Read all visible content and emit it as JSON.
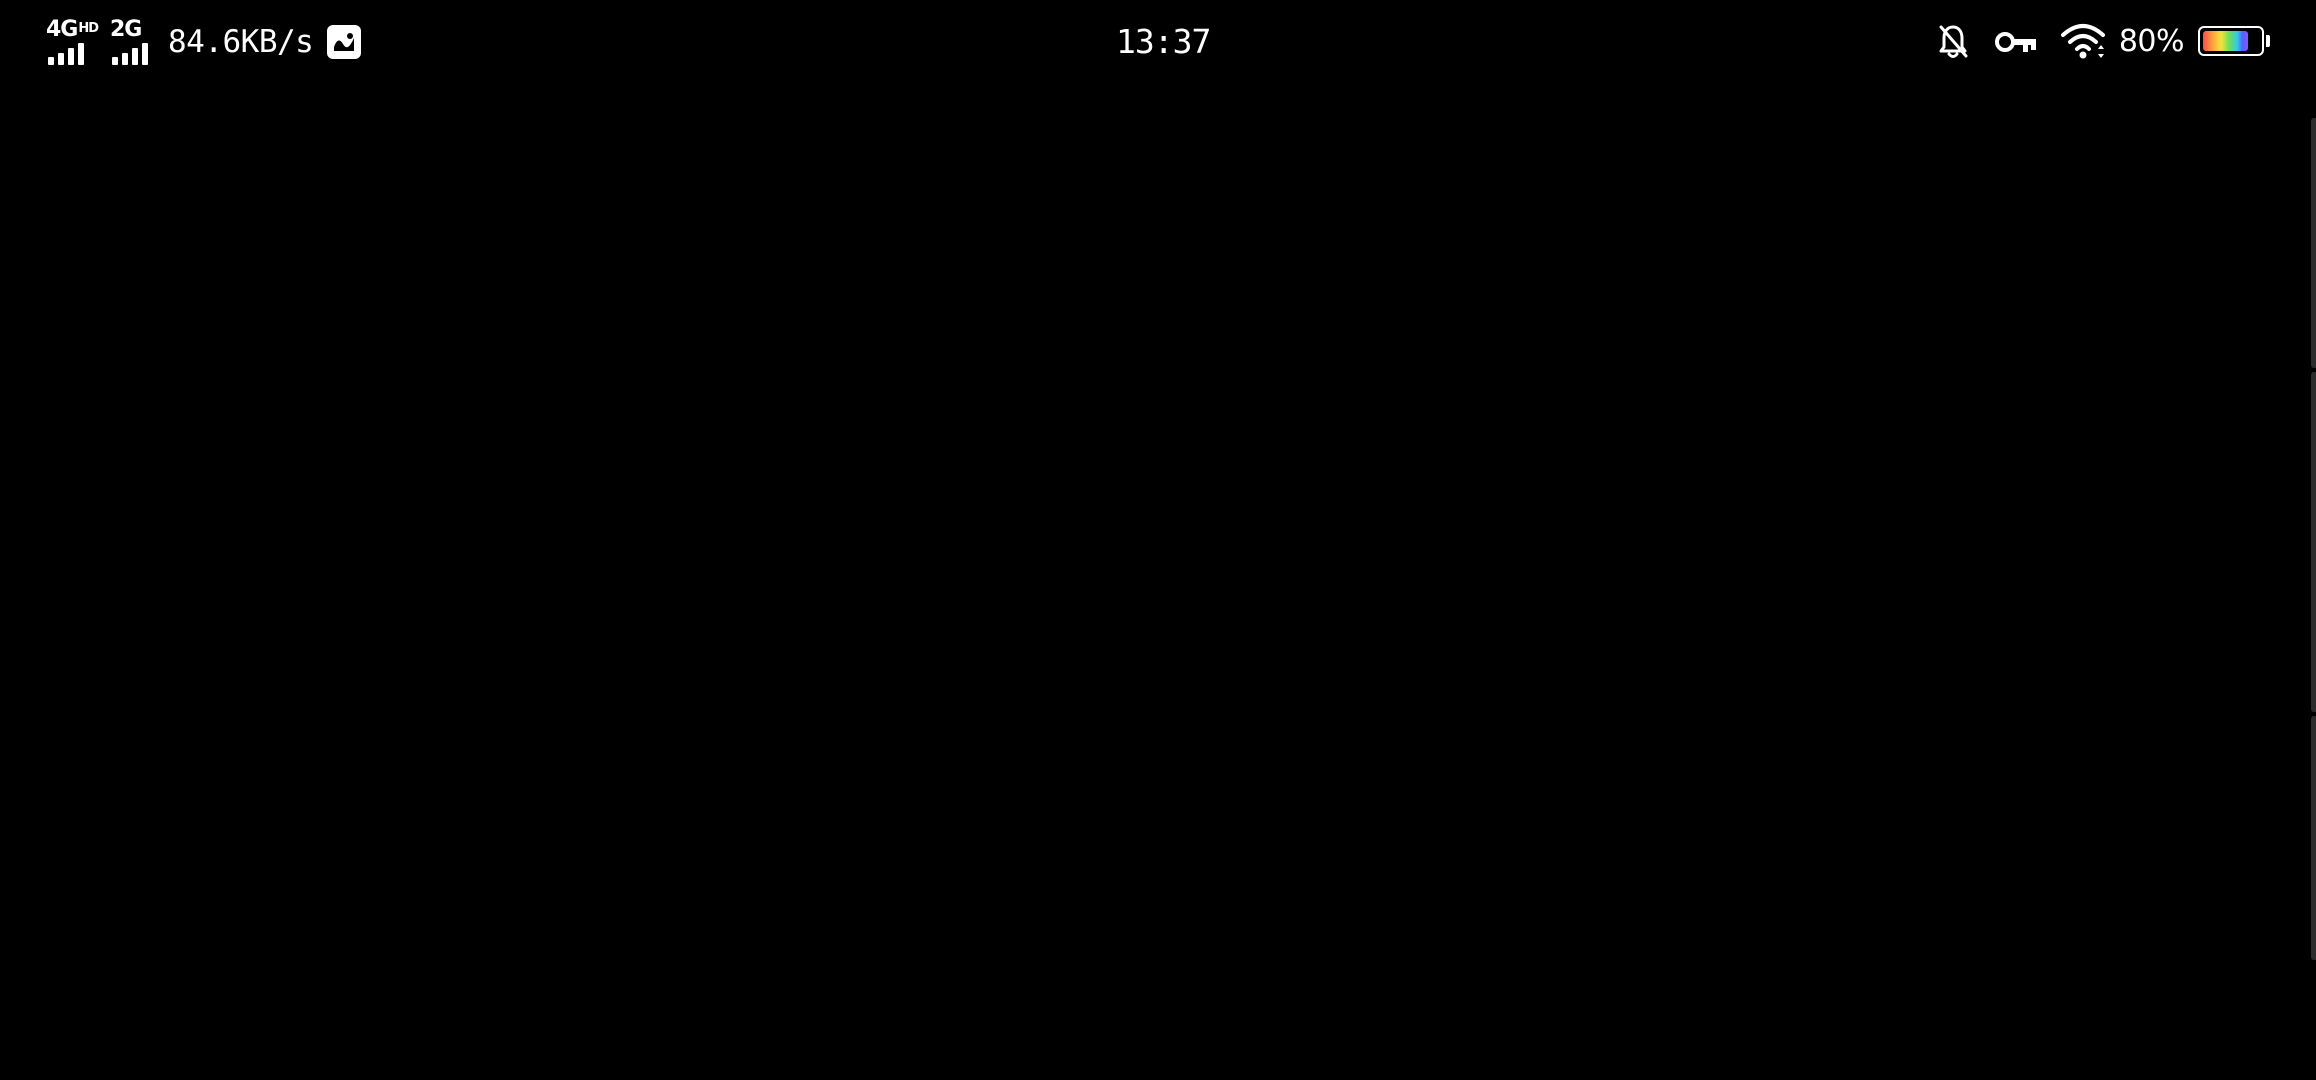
{
  "status_bar": {
    "network": {
      "sim1_label": "4G",
      "sim1_badge": "HD",
      "sim1_level": 4,
      "sim2_label": "2G",
      "sim2_level": 4,
      "speed": "84.6KB/s",
      "notification_icon": "image-app-icon"
    },
    "clock": "13:37",
    "right_icons": [
      "bell-off-icon",
      "vpn-key-icon",
      "wifi-icon"
    ],
    "battery": {
      "percent_text": "80%",
      "level": 0.8
    }
  },
  "colors": {
    "background": "#000000",
    "foreground": "#ffffff",
    "edge_handle": "#2c2c2c"
  }
}
